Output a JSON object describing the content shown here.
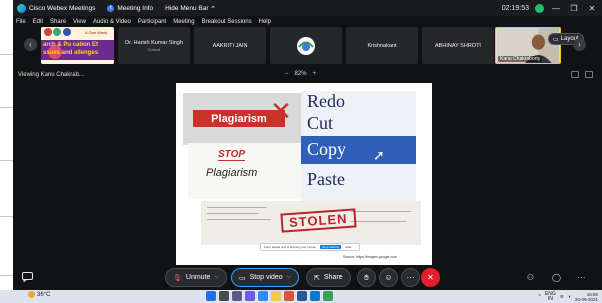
{
  "window": {
    "app_title": "Cisco Webex Meetings",
    "meeting_info": "Meeting Info",
    "hide_menu": "Hide Menu Bar",
    "hide_menu_chevron": "^",
    "timer": "02:19:53"
  },
  "menu": [
    "File",
    "Edit",
    "Share",
    "View",
    "Audio & Video",
    "Participant",
    "Meeting",
    "Breakout Sessions",
    "Help"
  ],
  "participants": [
    {
      "name": "Dr. Harish Kumar Singh",
      "role": "Cohost"
    },
    {
      "name": "AAKRITI JAIN"
    },
    {
      "name": "Krishnakant"
    },
    {
      "name": "ABHINAY SHROTI"
    },
    {
      "name": "Kanu Chakraborty"
    }
  ],
  "share_thumb": {
    "line1": "A One Week",
    "line2": "arch & Pu cation Et",
    "line3": "ssues and allenges"
  },
  "layout_button": "Layout",
  "viewbar": {
    "viewing": "Viewing Kanu Chakrab...",
    "zoom_minus": "−",
    "zoom_value": "82%",
    "zoom_plus": "+"
  },
  "slide": {
    "plagiarism": "Plagiarism",
    "menu_redo": "Redo",
    "menu_cut": "Cut",
    "menu_copy": "Copy",
    "menu_paste": "Paste",
    "stop": "STOP",
    "plagiarism_hand": "Plagiarism",
    "stolen": "STOLEN",
    "sharebar_text": "Kanu added and is sharing your screen",
    "sharebar_stop": "Stop sharing",
    "sharebar_hide": "Hide",
    "source": "Source: https://images.google.com"
  },
  "controls": {
    "unmute": "Unmute",
    "stop_video": "Stop video",
    "share": "Share",
    "more": "···",
    "end": "✕"
  },
  "taskbar": {
    "temperature": "36°C",
    "lang": "ENG",
    "lang_sub": "IN",
    "time": "16:50",
    "date": "20-09-2021"
  },
  "colors": {
    "app_bg": "#111214",
    "accent_blue": "#2aa3ff",
    "end_red": "#e0202f",
    "recording_green": "#21c16b",
    "camera_frame": "#f5c518"
  }
}
